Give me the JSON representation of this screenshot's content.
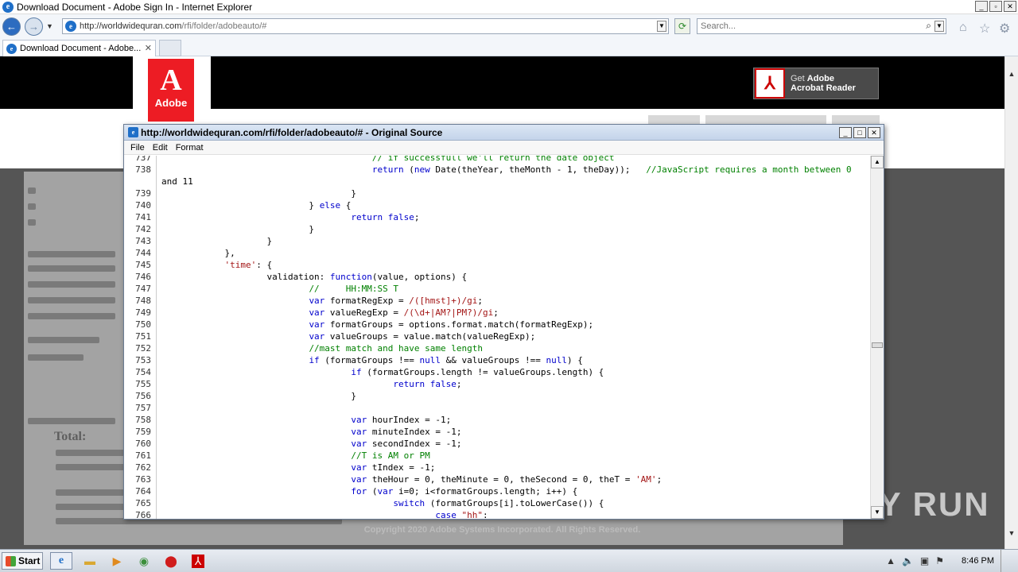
{
  "window": {
    "title": "Download Document - Adobe Sign In - Internet Explorer",
    "controls": [
      "_",
      "▫",
      "✕"
    ]
  },
  "nav": {
    "url_domain": "http://worldwidequran.com",
    "url_path": "/rfi/folder/adobeauto/#",
    "search_placeholder": "Search..."
  },
  "tabs": [
    {
      "label": "Download Document - Adobe..."
    }
  ],
  "page": {
    "logo_text": "Adobe",
    "get_reader_line1_prefix": "Get ",
    "get_reader_line1_bold": "Adobe",
    "get_reader_line2": "Acrobat Reader",
    "footer": "Copyright 2020 Adobe Systems Incorporated. All Rights Reserved.",
    "watermark": "ANY RUN",
    "blurred_text": [
      "Total:"
    ]
  },
  "source_window": {
    "title": "http://worldwidequran.com/rfi/folder/adobeauto/# - Original Source",
    "menu": [
      "File",
      "Edit",
      "Format"
    ],
    "lines": [
      {
        "n": "737",
        "t": "                                        // if successfull we'll return the date object"
      },
      {
        "n": "738",
        "t": "                                        return (new Date(theYear, theMonth - 1, theDay));   //JavaScript requires a month between 0"
      },
      {
        "n": "",
        "t": "and 11"
      },
      {
        "n": "739",
        "t": "                                    }"
      },
      {
        "n": "740",
        "t": "                            } else {"
      },
      {
        "n": "741",
        "t": "                                    return false;"
      },
      {
        "n": "742",
        "t": "                            }"
      },
      {
        "n": "743",
        "t": "                    }"
      },
      {
        "n": "744",
        "t": "            },"
      },
      {
        "n": "745",
        "t": "            'time': {"
      },
      {
        "n": "746",
        "t": "                    validation: function(value, options) {"
      },
      {
        "n": "747",
        "t": "                            //     HH:MM:SS T"
      },
      {
        "n": "748",
        "t": "                            var formatRegExp = /([hmst]+)/gi;"
      },
      {
        "n": "749",
        "t": "                            var valueRegExp = /(\\d+|AM?|PM?)/gi;"
      },
      {
        "n": "750",
        "t": "                            var formatGroups = options.format.match(formatRegExp);"
      },
      {
        "n": "751",
        "t": "                            var valueGroups = value.match(valueRegExp);"
      },
      {
        "n": "752",
        "t": "                            //mast match and have same length"
      },
      {
        "n": "753",
        "t": "                            if (formatGroups !== null && valueGroups !== null) {"
      },
      {
        "n": "754",
        "t": "                                    if (formatGroups.length != valueGroups.length) {"
      },
      {
        "n": "755",
        "t": "                                            return false;"
      },
      {
        "n": "756",
        "t": "                                    }"
      },
      {
        "n": "757",
        "t": ""
      },
      {
        "n": "758",
        "t": "                                    var hourIndex = -1;"
      },
      {
        "n": "759",
        "t": "                                    var minuteIndex = -1;"
      },
      {
        "n": "760",
        "t": "                                    var secondIndex = -1;"
      },
      {
        "n": "761",
        "t": "                                    //T is AM or PM"
      },
      {
        "n": "762",
        "t": "                                    var tIndex = -1;"
      },
      {
        "n": "763",
        "t": "                                    var theHour = 0, theMinute = 0, theSecond = 0, theT = 'AM';"
      },
      {
        "n": "764",
        "t": "                                    for (var i=0; i<formatGroups.length; i++) {"
      },
      {
        "n": "765",
        "t": "                                            switch (formatGroups[i].toLowerCase()) {"
      },
      {
        "n": "766",
        "t": "                                                    case \"hh\":"
      }
    ]
  },
  "taskbar": {
    "start_label": "Start",
    "clock": "8:46 PM"
  }
}
